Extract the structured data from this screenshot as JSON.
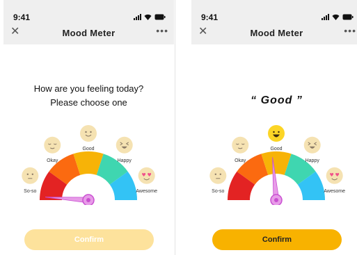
{
  "status_bar": {
    "time": "9:41"
  },
  "screens": [
    {
      "nav": {
        "title": "Mood Meter",
        "close_icon": "close-icon",
        "more_icon": "more-icon"
      },
      "prompt": {
        "line1": "How are you feeling today?",
        "line2": "Please choose one"
      },
      "selected_mood": null,
      "confirm": {
        "label": "Confirm",
        "enabled": false
      }
    },
    {
      "nav": {
        "title": "Mood Meter",
        "close_icon": "close-icon",
        "more_icon": "more-icon"
      },
      "result": {
        "text": "“ Good ”"
      },
      "selected_mood": "Good",
      "confirm": {
        "label": "Confirm",
        "enabled": true
      }
    }
  ],
  "moods": [
    {
      "label": "So-so",
      "segment_color": "#e32323",
      "face": "neutral"
    },
    {
      "label": "Okay",
      "segment_color": "#fb6a10",
      "face": "content"
    },
    {
      "label": "Good",
      "segment_color": "#f7b307",
      "face": "smile"
    },
    {
      "label": "Happy",
      "segment_color": "#3fd6b0",
      "face": "laugh"
    },
    {
      "label": "Awesome",
      "segment_color": "#33c3f5",
      "face": "love"
    }
  ],
  "colors": {
    "needle": "#c94fd1",
    "needle_light": "#e79be8",
    "emoji_face_inactive": "#f5e2b2",
    "emoji_face_active": "#fcd526",
    "confirm_disabled": "#fde29c",
    "confirm_active": "#f8b200"
  },
  "needle_angles_deg": [
    176,
    95
  ]
}
